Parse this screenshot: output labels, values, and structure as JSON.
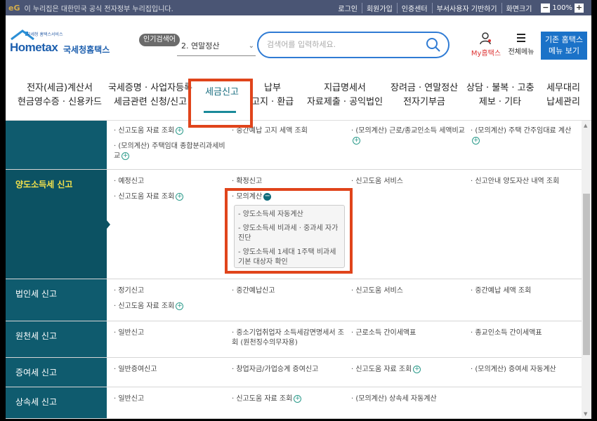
{
  "topbar": {
    "gov_logo": "eG",
    "gov_text": "이 누리집은 대한민국 공식 전자정부 누리집입니다.",
    "links": [
      "로그인",
      "회원가입",
      "인증센터",
      "부서사용자 기반하기",
      "화면크기"
    ],
    "zoom_minus": "−",
    "zoom": "100%",
    "zoom_plus": "+"
  },
  "header": {
    "logo_small": "국세청 홈택스서비스",
    "logo_main": "Hometax",
    "logo_kor": "국세청홈택스",
    "popular_label": "인기검색어",
    "popular_value": "2.  연말정산",
    "search_placeholder": "검색어를 입력하세요.",
    "myhome": "My홈택스",
    "allmenu": "전체메뉴",
    "old_btn_line1": "기존 홈택스",
    "old_btn_line2": "메뉴 보기"
  },
  "gnb": [
    {
      "l1": "전자(세금)계산서",
      "l2": "현금영수증 · 신용카드"
    },
    {
      "l1": "국세증명 · 사업자등록",
      "l2": "세금관련 신청/신고"
    },
    {
      "l1": "세금신고",
      "l2": ""
    },
    {
      "l1": "납부",
      "l2": "고지 · 환급"
    },
    {
      "l1": "지급명세서",
      "l2": "자료제출 · 공익법인"
    },
    {
      "l1": "장려금 · 연말정산",
      "l2": "전자기부금"
    },
    {
      "l1": "상담 · 불복 · 고충",
      "l2": "제보 · 기타"
    },
    {
      "l1": "세무대리",
      "l2": "납세관리"
    }
  ],
  "rows": [
    {
      "cat": "",
      "cells": [
        "· 신고도움 자료 조회",
        "· 중간예납 고지 세액 조회",
        "· (모의계산) 근로/종교인소득 세액비교",
        "· (모의계산) 주택 간주임대료 계산"
      ],
      "extra": "· (모의계산) 주택임대 종합분리과세비교"
    },
    {
      "cat": "양도소득세 신고",
      "cells": [
        "· 예정신고",
        "· 확정신고",
        "· 신고도움 서비스",
        "· 신고안내 양도자산 내역 조회"
      ],
      "cells2": [
        "· 신고도움 자료 조회",
        "· 모의계산"
      ],
      "sub": [
        "- 양도소득세 자동계산",
        "- 양도소득세 비과세 · 중과세 자가진단",
        "- 양도소득세 1세대 1주택 비과세 기본 대상자 확인"
      ]
    },
    {
      "cat": "법인세 신고",
      "cells": [
        "· 정기신고",
        "· 중간예납신고",
        "· 신고도움 서비스",
        "· 중간예납 세액 조회"
      ],
      "cells2": [
        "· 신고도움 자료 조회"
      ]
    },
    {
      "cat": "원천세 신고",
      "cells": [
        "· 일반신고",
        "· 중소기업취업자 소득세감면명세서 조회 (원천징수의무자용)",
        "· 근로소득 간이세액표",
        "· 종교인소득 간이세액표"
      ]
    },
    {
      "cat": "증여세 신고",
      "cells": [
        "· 일반증여신고",
        "· 창업자금/가업승계 증여신고",
        "· 신고도움 자료 조회",
        "· (모의계산) 증여세 자동계산"
      ]
    },
    {
      "cat": "상속세 신고",
      "cells": [
        "· 일반신고",
        "· 신고도움 자료 조회",
        "· (모의계산) 상속세 자동계산",
        ""
      ]
    }
  ]
}
